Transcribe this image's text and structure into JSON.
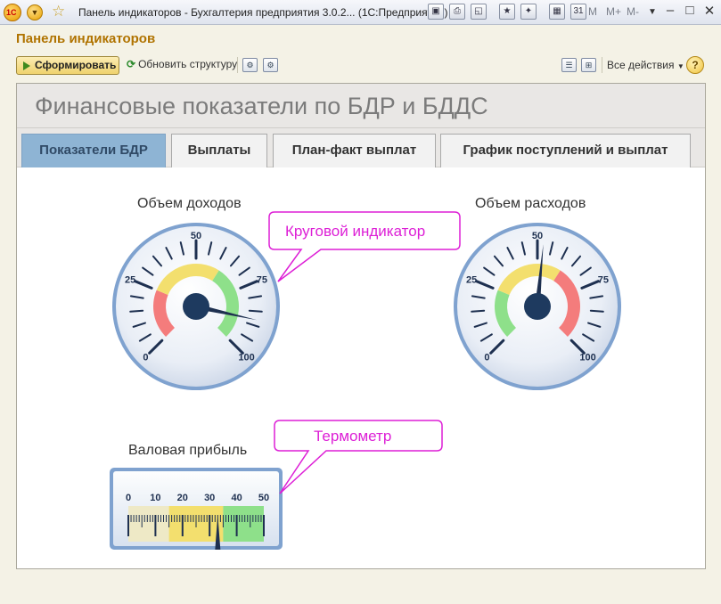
{
  "window": {
    "logo_text": "1С",
    "title": "Панель индикаторов - Бухгалтерия предприятия 3.0.2...  (1С:Предприятие)",
    "memory_buttons": [
      "M",
      "M+",
      "M-"
    ]
  },
  "page_title": "Панель индикаторов",
  "toolbar": {
    "generate_label": "Сформировать",
    "refresh_label": "Обновить структуру",
    "all_actions_label": "Все действия",
    "help_label": "?"
  },
  "report": {
    "header": "Финансовые показатели по БДР и БДДС",
    "tabs": [
      {
        "label": "Показатели БДР",
        "active": true
      },
      {
        "label": "Выплаты",
        "active": false
      },
      {
        "label": "План-факт выплат",
        "active": false
      },
      {
        "label": "График поступлений и выплат",
        "active": false
      }
    ]
  },
  "gauges": {
    "income": {
      "title": "Объем доходов",
      "min": 0,
      "max": 100,
      "value": 88,
      "scale_labels": [
        "0",
        "25",
        "50",
        "75",
        "100"
      ],
      "bands": [
        {
          "from": 0,
          "to": 25,
          "color": "#f47c7c"
        },
        {
          "from": 25,
          "to": 62,
          "color": "#f3df6e"
        },
        {
          "from": 62,
          "to": 100,
          "color": "#8ee08a"
        }
      ]
    },
    "expenses": {
      "title": "Объем расходов",
      "min": 0,
      "max": 100,
      "value": 52,
      "scale_labels": [
        "0",
        "25",
        "50",
        "75",
        "100"
      ],
      "bands": [
        {
          "from": 0,
          "to": 25,
          "color": "#8ee08a"
        },
        {
          "from": 25,
          "to": 62,
          "color": "#f3df6e"
        },
        {
          "from": 62,
          "to": 100,
          "color": "#f47c7c"
        }
      ]
    }
  },
  "thermometer": {
    "title": "Валовая прибыль",
    "min": 0,
    "max": 50,
    "value": 33,
    "scale_labels": [
      "0",
      "10",
      "20",
      "30",
      "40",
      "50"
    ],
    "bands": [
      {
        "from": 0,
        "to": 15,
        "color": "#eee9c6"
      },
      {
        "from": 15,
        "to": 35,
        "color": "#f3df6e"
      },
      {
        "from": 35,
        "to": 50,
        "color": "#8ee08a"
      }
    ]
  },
  "callouts": {
    "gauge": "Круговой индикатор",
    "thermometer": "Термометр",
    "color": "#dd1fd6"
  },
  "icons": {
    "title_bar": [
      "save-icon",
      "print-icon",
      "preview-icon",
      "favorite-add-icon",
      "bookmark-icon",
      "calculator-icon",
      "calendar-icon"
    ],
    "toolbar": [
      "settings-icon",
      "save-settings-icon",
      "list-icon",
      "structure-icon",
      "help-icon"
    ]
  }
}
